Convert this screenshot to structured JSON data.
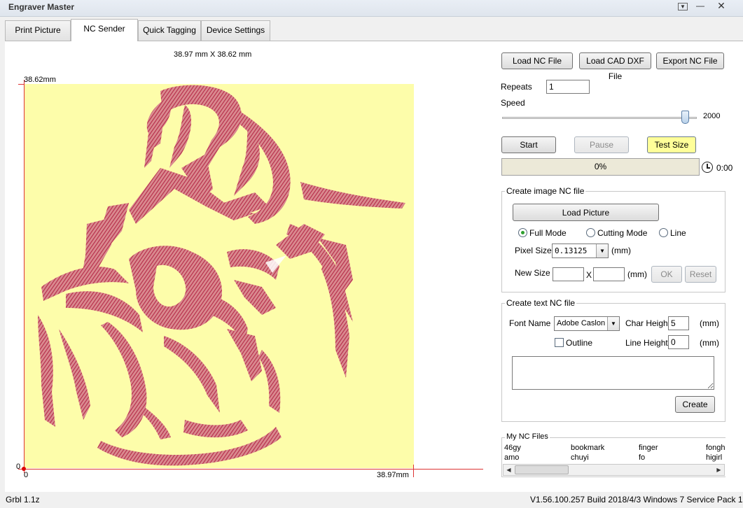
{
  "window": {
    "title": "Engraver Master"
  },
  "tabs": [
    {
      "label": "Print Picture"
    },
    {
      "label": "NC Sender"
    },
    {
      "label": "Quick Tagging"
    },
    {
      "label": "Device Settings"
    }
  ],
  "active_tab": "NC Sender",
  "canvas": {
    "size_label": "38.97 mm X 38.62 mm",
    "y_max_label": "38.62mm",
    "y_min_label": "0",
    "x_min_label": "0",
    "x_max_label": "38.97mm",
    "background_color": "#fdfdaa",
    "engraving_color": "#c23b55",
    "axis_color": "#d33333"
  },
  "toolbar": {
    "load_nc": "Load NC File",
    "load_cad": "Load CAD DXF File",
    "export_nc": "Export NC File"
  },
  "controls": {
    "repeats_label": "Repeats",
    "repeats_value": "1",
    "speed_label": "Speed",
    "speed_value": "2000",
    "speed_fraction": 0.96
  },
  "job": {
    "start": "Start",
    "pause": "Pause",
    "test_size": "Test Size",
    "progress": "0%",
    "progress_value": 0,
    "elapsed": "0:00"
  },
  "image_nc": {
    "legend": "Create image NC file",
    "load_picture": "Load Picture",
    "modes": [
      {
        "label": "Full Mode",
        "checked": true
      },
      {
        "label": "Cutting Mode",
        "checked": false
      },
      {
        "label": "Line",
        "checked": false
      }
    ],
    "pixel_size_label": "Pixel Size",
    "pixel_size_value": "0.13125",
    "pixel_size_unit": "(mm)",
    "new_size_label": "New Size",
    "new_size_x": "X",
    "new_size_unit": "(mm)",
    "ok": "OK",
    "reset": "Reset"
  },
  "text_nc": {
    "legend": "Create text NC file",
    "font_name_label": "Font Name",
    "font_name_value": "Adobe Caslon",
    "char_height_label": "Char Height",
    "char_height_value": "5",
    "char_height_unit": "(mm)",
    "outline_label": "Outline",
    "line_height_label": "Line Height",
    "line_height_value": "0",
    "line_height_unit": "(mm)",
    "create": "Create"
  },
  "nc_files": {
    "legend": "My NC Files",
    "row1": [
      "46gy",
      "bookmark",
      "finger",
      "fongh"
    ],
    "row2": [
      "amo",
      "chuyi",
      "fo",
      "higirl"
    ]
  },
  "status": {
    "left": "Grbl 1.1z",
    "right": "V1.56.100.257 Build 2018/4/3 Windows 7 Service Pack 1"
  }
}
